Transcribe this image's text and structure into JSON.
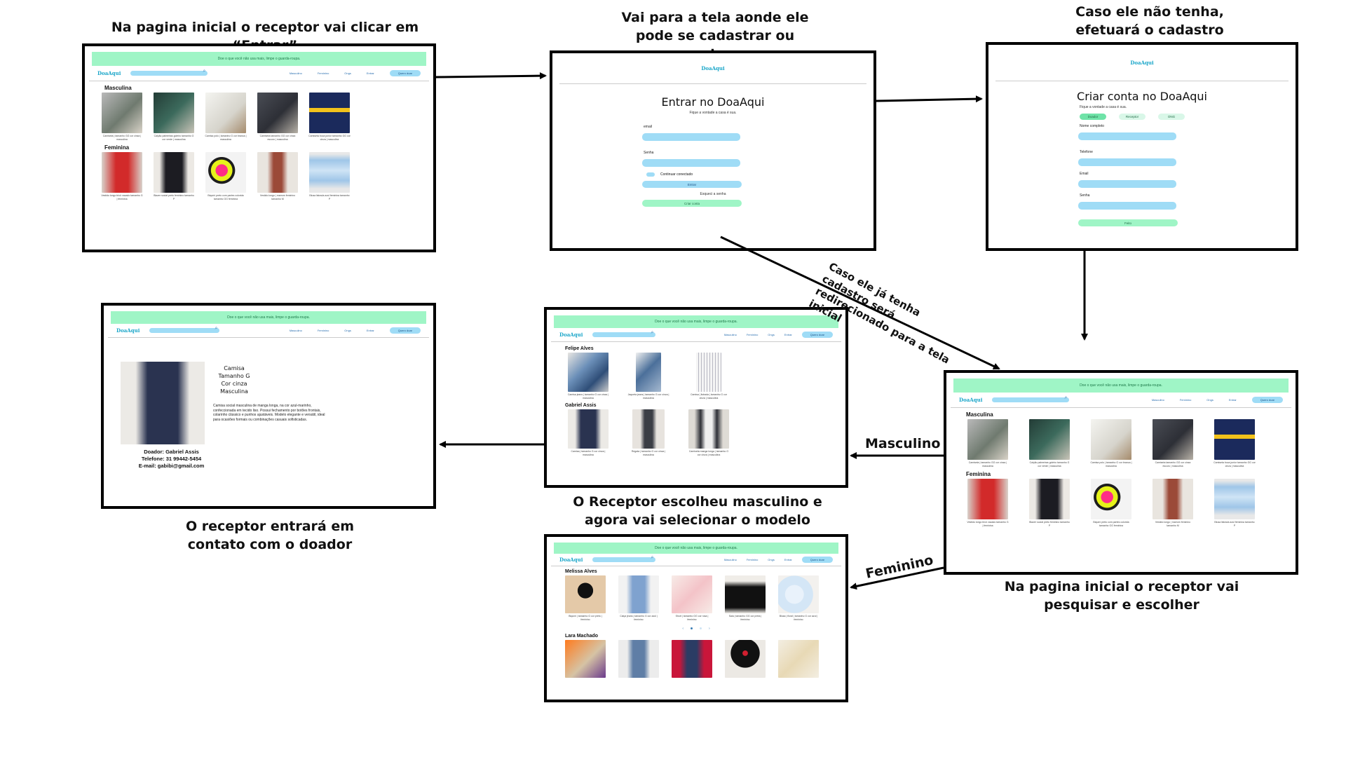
{
  "captions": {
    "home": "Na pagina inicial o receptor vai clicar em “Entrar”",
    "auth": "Vai para a tela aonde ele pode se cadastrar ou entrar",
    "signup": "Caso ele não tenha, efetuará o cadastro",
    "search": "Na pagina inicial o receptor vai pesquisar e escolher",
    "male": "O Receptor escolheu masculino e agora vai selecionar o modelo",
    "contact": "O receptor entrará em contato com o doador"
  },
  "edges": {
    "redirect": "Caso ele já tenha cadastro será redirecionado para a tela inicial",
    "masculino": "Masculino",
    "feminino": "Feminino"
  },
  "site": {
    "logo": "DoaAqui",
    "banner": "Doe o que você não usa mais, limpe o guarda-roupa.",
    "nav": {
      "masculino": "Masculino",
      "feminino": "Feminino",
      "ongs": "Ongs",
      "entrar": "Entrar",
      "quero_doar": "Quero doar"
    }
  },
  "home": {
    "section_masculina": "Masculina",
    "section_feminina": "Feminina",
    "masculina": [
      {
        "cap": "Camiseta | tamanho GG cor cinza | masculina"
      },
      {
        "cap": "Calção palmeiras goleiro tamanho G cor verde | masculina"
      },
      {
        "cap": "Camisa polo | tamanho G cor branca | masculina"
      },
      {
        "cap": "Camiseta tamanho GG cor cinza escuro | masculina"
      },
      {
        "cap": "Camiseta boca junior tamanho GG cor cinza | masculina"
      }
    ],
    "feminina": [
      {
        "cap": "Vestido longo tricô vazado tamanho G | feminina"
      },
      {
        "cap": "Blazer social preto feminino tamanho P"
      },
      {
        "cap": "Biquíni preto com partes colorida tamanho GG feminina"
      },
      {
        "cap": "Vestido longo | marrom feminino tamanho M"
      },
      {
        "cap": "Blusa listrada azul feminina tamanho P"
      }
    ]
  },
  "login": {
    "title": "Entrar no DoaAqui",
    "subtitle": "Fique a vontade a casa é sua.",
    "email_label": "email",
    "senha_label": "Senha",
    "keep": "Continuar conectado",
    "entrar": "Entrar",
    "forgot": "Esqueci a senha",
    "create": "Criar conta"
  },
  "signup": {
    "title": "Criar conta no DoaAqui",
    "subtitle": "Fique a vontade a casa é sua.",
    "roles": [
      "Doador",
      "Receptor",
      "ONG"
    ],
    "nome": "Nome completo",
    "telefone": "Telefone",
    "email": "Email",
    "senha": "Senha",
    "feito": "Feito"
  },
  "male_models": {
    "donor1": "Felipe Alves",
    "donor2": "Gabriel Assis",
    "row1": [
      {
        "cap": "Camisa jeans | tamanho G cor cinza | masculina"
      },
      {
        "cap": "Jaqueta jeans | tamanho G cor cinza | masculina"
      },
      {
        "cap": "Camisa | listrada | tamanho G cor cinza | masculina"
      }
    ],
    "row2": [
      {
        "cap": "Camisa | tamanho G cor cinza | masculina"
      },
      {
        "cap": "Regata | tamanho G cor cinza | masculina"
      },
      {
        "cap": "Camiseta manga longa | tamanho G cor cinza | masculina"
      }
    ]
  },
  "female_models": {
    "donor1": "Melissa Alves",
    "donor2": "Lara Machado",
    "row1": [
      {
        "cap": "Biquíni | tamanho G cor preto | feminino"
      },
      {
        "cap": "Calça jeans | tamanho G cor azul | feminino"
      },
      {
        "cap": "Short | tamanho GG cor rosa | feminino"
      },
      {
        "cap": "Saia | tamanho GG cor preta | feminino"
      },
      {
        "cap": "Blusa | floral | tamanho G cor azul | feminino"
      }
    ]
  },
  "detail": {
    "attr1": "Camisa",
    "attr2": "Tamanho G",
    "attr3": "Cor cinza",
    "attr4": "Masculina",
    "desc": "Camisa social masculina de manga longa, na cor azul-marinho, confeccionada em tecido liso. Possui fechamento por botões frontais, colarinho clássico e punhos ajustáveis. Modelo elegante e versátil, ideal para ocasiões formais ou combinações casuais sofisticadas.",
    "donor": "Doador: Gabriel Assis",
    "phone": "Telefone: 31 99442-5454",
    "email": "E-mail: gabibi@gmail.com"
  }
}
